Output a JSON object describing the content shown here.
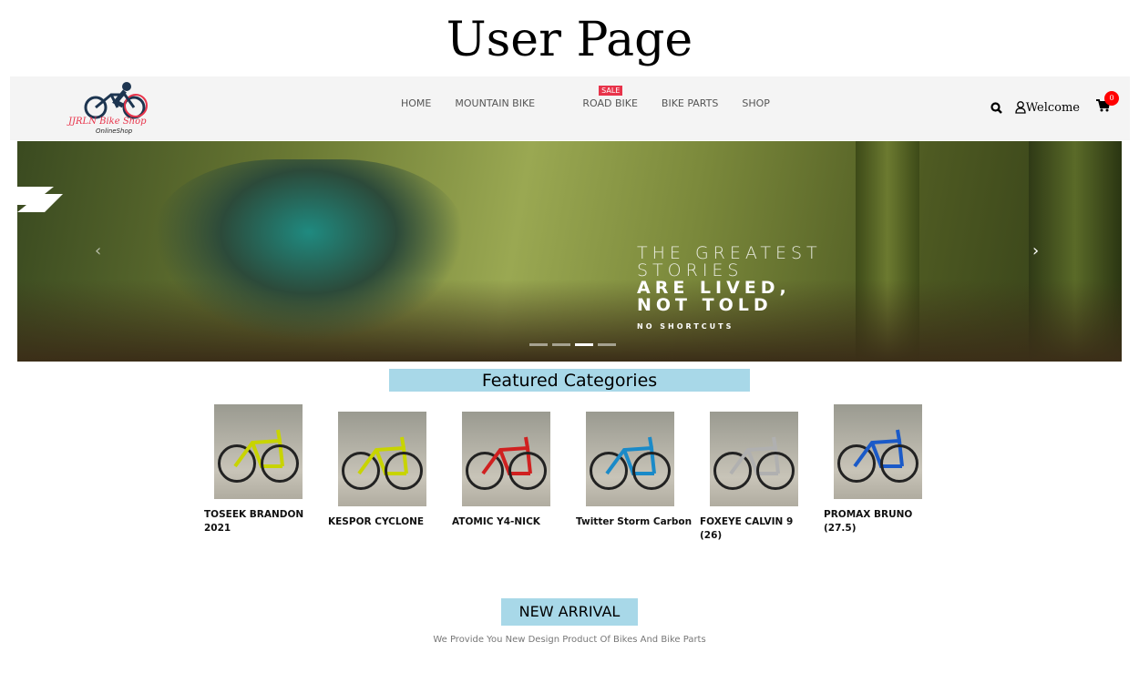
{
  "page_title": "User Page",
  "logo": {
    "name": "JJRLN Bike Shop",
    "tagline": "OnlineShop"
  },
  "nav": {
    "items": [
      "HOME",
      "MOUNTAIN BIKE",
      "ROAD BIKE",
      "BIKE PARTS",
      "SHOP"
    ],
    "sale_badge": "SALE",
    "welcome": "Welcome",
    "cart_count": "0"
  },
  "banner": {
    "line1": "THE GREATEST",
    "line2": "STORIES",
    "line3": "ARE LIVED,",
    "line4": "NOT TOLD",
    "tag": "NO SHORTCUTS",
    "prev": "‹",
    "next": "›"
  },
  "featured": {
    "title": "Featured Categories",
    "products": [
      {
        "name": "TOSEEK BRANDON 2021",
        "color": "#c8d400"
      },
      {
        "name": "KESPOR CYCLONE",
        "color": "#c8d400"
      },
      {
        "name": "ATOMIC Y4-NICK",
        "color": "#d02020"
      },
      {
        "name": "Twitter Storm Carbon",
        "color": "#1a8ac8"
      },
      {
        "name": "FOXEYE CALVIN 9 (26)",
        "color": "#b0b0b0"
      },
      {
        "name": "PROMAX BRUNO (27.5)",
        "color": "#1a5ac8"
      }
    ]
  },
  "new_arrival": {
    "title": "NEW ARRIVAL",
    "subtitle": "We Provide You New Design Product Of Bikes And Bike Parts"
  }
}
